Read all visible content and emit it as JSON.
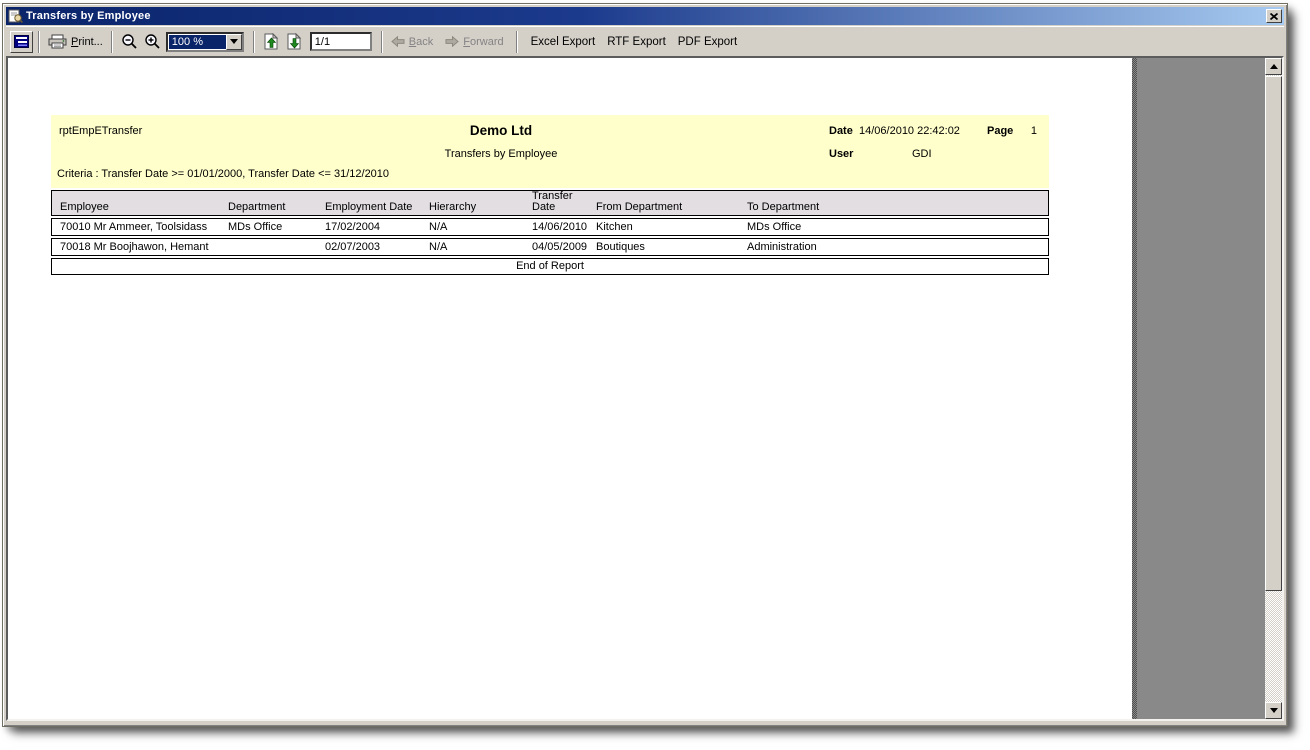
{
  "window": {
    "title": "Transfers by Employee"
  },
  "toolbar": {
    "print": {
      "key": "P",
      "rest": "rint..."
    },
    "zoom_value": "100 %",
    "page_indicator": "1/1",
    "back": {
      "key": "B",
      "rest": "ack"
    },
    "forward": {
      "key": "F",
      "rest": "orward"
    },
    "exports": {
      "excel": "Excel Export",
      "rtf": "RTF Export",
      "pdf": "PDF Export"
    }
  },
  "report": {
    "name": "rptEmpETransfer",
    "company": "Demo Ltd",
    "title": "Transfers by Employee",
    "date_label": "Date",
    "date_value": "14/06/2010 22:42:02",
    "page_label": "Page",
    "page_value": "1",
    "user_label": "User",
    "user_value": "GDI",
    "criteria": "Criteria : Transfer Date >= 01/01/2000, Transfer Date <= 31/12/2010",
    "columns": [
      "Employee",
      "Department",
      "Employment Date",
      "Hierarchy",
      "Transfer Date",
      "From Department",
      "To Department"
    ],
    "rows": [
      [
        "70010 Mr Ammeer, Toolsidass",
        "MDs Office",
        "17/02/2004",
        "N/A",
        "14/06/2010",
        "Kitchen",
        "MDs Office"
      ],
      [
        "70018 Mr Boojhawon, Hemant",
        "",
        "02/07/2003",
        "N/A",
        "04/05/2009",
        "Boutiques",
        "Administration"
      ]
    ],
    "footer": "End of Report"
  },
  "colors": {
    "titlebar_start": "#0a246a",
    "titlebar_end": "#a6caf0",
    "toolbar_bg": "#d4d0c8",
    "canvas_bg": "#898989",
    "band_bg": "#ffffcc",
    "header_row_bg": "#e2dee2",
    "highlight": "#0a246a"
  }
}
